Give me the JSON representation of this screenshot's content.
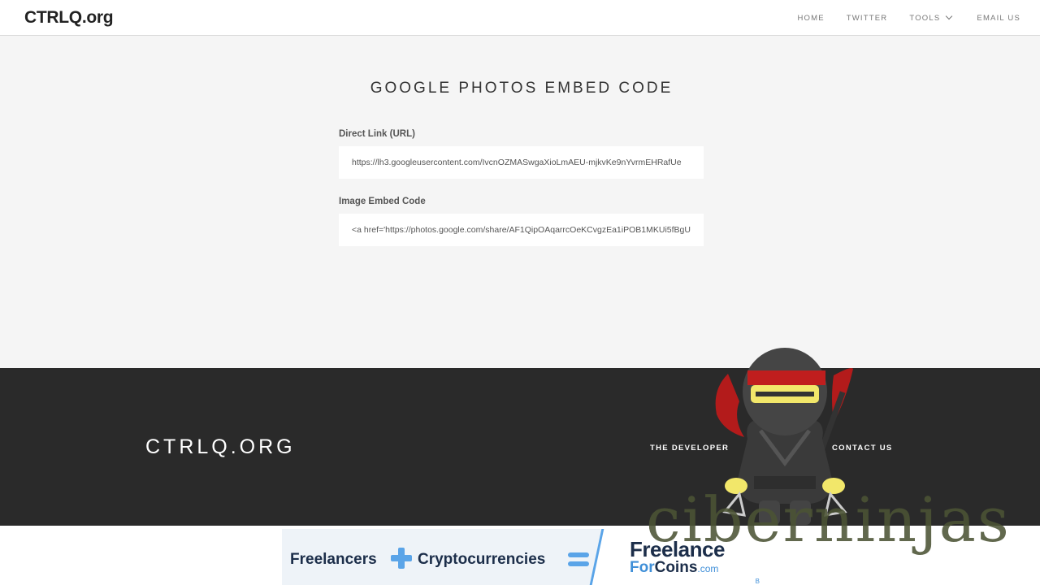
{
  "header": {
    "brand": "CTRLQ.org",
    "nav": [
      {
        "label": "HOME"
      },
      {
        "label": "TWITTER"
      },
      {
        "label": "TOOLS"
      },
      {
        "label": "EMAIL US"
      }
    ]
  },
  "main": {
    "title": "GOOGLE PHOTOS EMBED CODE",
    "direct_link": {
      "label": "Direct Link (URL)",
      "value": "https://lh3.googleusercontent.com/IvcnOZMASwgaXioLmAEU-mjkvKe9nYvrmEHRafUe"
    },
    "embed_code": {
      "label": "Image Embed Code",
      "value": "<a href='https://photos.google.com/share/AF1QipOAqarrcOeKCvgzEa1iPOB1MKUi5fBgU"
    }
  },
  "footer": {
    "brand": "CTRLQ.ORG",
    "links": [
      {
        "label": "THE DEVELOPER"
      },
      {
        "label": "CONTACT US"
      }
    ]
  },
  "ad": {
    "part1": "Freelancers",
    "part2": "Cryptocurrencies",
    "brand_line1": "Freelance",
    "brand_line2_a": "For",
    "brand_line2_b": "Coins",
    "brand_domain": ".com",
    "badge": "B",
    "accent": "#5aa4e8"
  },
  "watermark": {
    "text": "ciberninjas",
    "icon": "ninja-mascot"
  }
}
